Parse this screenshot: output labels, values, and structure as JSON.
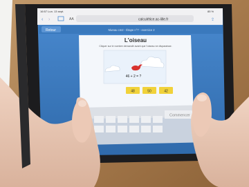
{
  "status_bar": {
    "time_date": "16:57  Lun. 13 sept.",
    "battery": "85 %"
  },
  "browser": {
    "text_size": "AA",
    "url": "calculétice.ac-lille.fr"
  },
  "nav": {
    "back_label": "Retour",
    "breadcrumb": "Niveau cm2 - Étape n°7 - exercice 2"
  },
  "exercise": {
    "title": "L'oiseau",
    "instruction": "Cliquer sur le nombre demandé avant que l'oiseau ne disparaisse.",
    "question": "46 + 2 = ?",
    "answers": [
      "48",
      "50",
      "42"
    ]
  },
  "keypad": {
    "start_label": "Commencer"
  },
  "colors": {
    "screen_blue": "#3f7fc4",
    "card_bg": "#f4f7fb",
    "answer_yellow": "#f1d23a",
    "bird_red": "#d8332f",
    "wood": "#a67a4c"
  }
}
